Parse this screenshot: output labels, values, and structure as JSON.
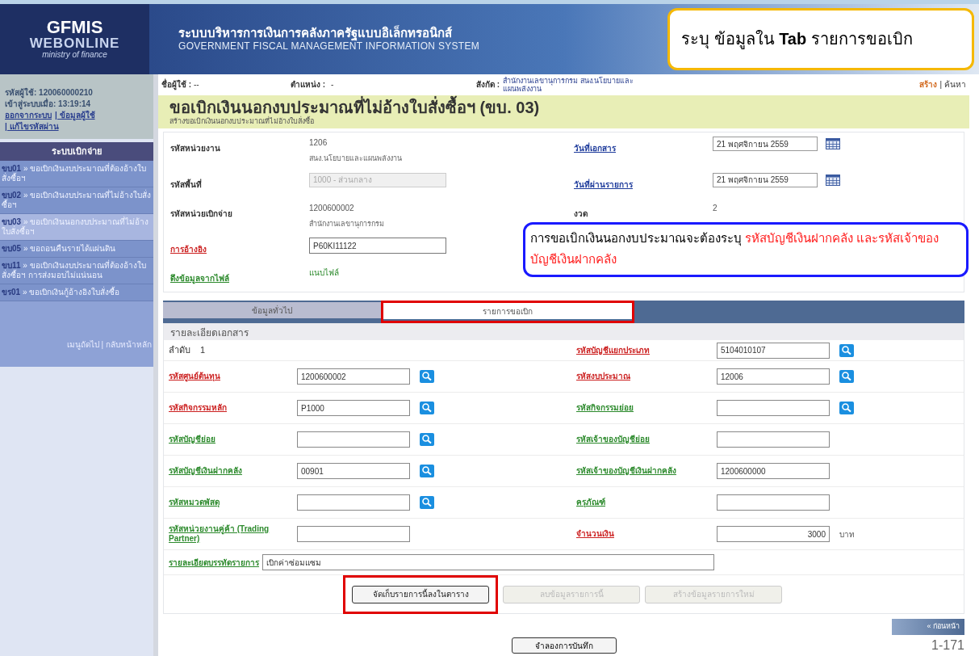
{
  "header": {
    "logo": [
      "GFMIS",
      "WEBONLINE",
      "ministry of finance"
    ],
    "title_th": "ระบบบริหารการเงินการคลังภาครัฐแบบอิเล็กทรอนิกส์",
    "title_en": "GOVERNMENT FISCAL MANAGEMENT INFORMATION SYSTEM"
  },
  "sidebar": {
    "user_id": "รหัสผู้ใช้: 120060000210",
    "login_time": "เข้าสู่ระบบเมื่อ: 13:19:14",
    "links": [
      "ออกจากระบบ",
      "| ข้อมูลผู้ใช้",
      "| แก้ไขรหัสผ่าน"
    ],
    "menu_title": "ระบบเบิกจ่าย",
    "menu_items": [
      {
        "code": "ขบ01",
        "label": "» ขอเบิกเงินงบประมาณที่ต้องอ้างใบสั่งซื้อฯ",
        "selected": false
      },
      {
        "code": "ขบ02",
        "label": "» ขอเบิกเงินงบประมาณที่ไม่อ้างใบสั่งซื้อฯ",
        "selected": false
      },
      {
        "code": "ขบ03",
        "label": "» ขอเบิกเงินนอกงบประมาณที่ไม่อ้างใบสั่งซื้อฯ",
        "selected": true
      },
      {
        "code": "ขบ05",
        "label": "» ขอถอนคืนรายได้แผ่นดิน",
        "selected": false
      },
      {
        "code": "ขบ11",
        "label": "» ขอเบิกเงินงบประมาณที่ต้องอ้างใบสั่งซื้อฯ การส่งมอบไม่แน่นอน",
        "selected": false
      },
      {
        "code": "ขร01",
        "label": "» ขอเบิกเงินกู้อ้างอิงใบสั่งซื้อ",
        "selected": false
      }
    ],
    "footer_links": [
      "เมนูถัดไป",
      "| กลับหน้าหลัก"
    ]
  },
  "topbar": {
    "user_label": "ชื่อผู้ใช้ :",
    "user_value": "--",
    "position_label": "ตำแหน่ง :",
    "position_value": "-",
    "org_label": "สังกัด :",
    "org_value": "สำนักงานเลขานุการกรม สนง.นโยบายและแผนพลังงาน",
    "actions": [
      {
        "label": "สร้าง",
        "selected": true
      },
      {
        "label": "| ค้นหา",
        "selected": false
      }
    ]
  },
  "page_title": "ขอเบิกเงินนอกงบประมาณที่ไม่อ้างใบสั่งซื้อฯ (ขบ. 03)",
  "page_subtitle": "สร้างขอเบิกเงินนอกงบประมาณที่ไม่อ้างใบสั่งซื้อ",
  "general_rows": [
    {
      "left": {
        "label": "รหัสหน่วยงาน",
        "link": false,
        "kind": "text",
        "value": "1206",
        "note": "สนง.นโยบายและแผนพลังงาน"
      },
      "right": {
        "label": "วันที่เอกสาร",
        "link": true,
        "required": false,
        "kind": "date",
        "value": "21 พฤศจิกายน 2559"
      }
    },
    {
      "left": {
        "label": "รหัสพื้นที่",
        "link": false,
        "kind": "select",
        "value": "1000 - ส่วนกลาง",
        "disabled": true
      },
      "right": {
        "label": "วันที่ผ่านรายการ",
        "link": true,
        "required": false,
        "kind": "date",
        "value": "21 พฤศจิกายน 2559"
      }
    },
    {
      "left": {
        "label": "รหัสหน่วยเบิกจ่าย",
        "link": false,
        "kind": "text",
        "value": "1200600002",
        "note": "สำนักงานเลขานุการกรม"
      },
      "right": {
        "label": "งวด",
        "link": false,
        "kind": "text",
        "value": "2"
      }
    },
    {
      "left": {
        "label": "การอ้างอิง",
        "link": true,
        "required": true,
        "kind": "input",
        "value": "P60KI11122"
      }
    },
    {
      "left": {
        "label": "ดึงข้อมูลจากไฟล์",
        "link": true,
        "required": false,
        "kind": "link",
        "value": "แนบไฟล์"
      }
    }
  ],
  "tabs": [
    {
      "label": "ข้อมูลทั่วไป",
      "selected": false,
      "highlighted": false
    },
    {
      "label": "รายการขอเบิก",
      "selected": true,
      "highlighted": true
    }
  ],
  "detail": {
    "title": "รายละเอียดเอกสาร",
    "rows": [
      {
        "left": {
          "kind": "seq",
          "label": "ลำดับ",
          "value": "1"
        },
        "right": {
          "kind": "input",
          "label": "รหัสบัญชีแยกประเภท",
          "required": true,
          "value": "5104010107",
          "lookup": true
        }
      },
      {
        "left": {
          "kind": "input",
          "label": "รหัสศูนย์ต้นทุน",
          "required": true,
          "value": "1200600002",
          "lookup": true
        },
        "right": {
          "kind": "input",
          "label": "รหัสงบประมาณ",
          "required": true,
          "value": "12006",
          "lookup": true
        }
      },
      {
        "left": {
          "kind": "input",
          "label": "รหัสกิจกรรมหลัก",
          "required": true,
          "value": "P1000",
          "lookup": true
        },
        "right": {
          "kind": "input",
          "label": "รหัสกิจกรรมย่อย",
          "required": false,
          "lookup": true
        }
      },
      {
        "left": {
          "kind": "input",
          "label": "รหัสบัญชีย่อย",
          "required": false,
          "lookup": true
        },
        "right": {
          "kind": "input",
          "label": "รหัสเจ้าของบัญชีย่อย",
          "required": false,
          "lookup": false
        }
      },
      {
        "left": {
          "kind": "input",
          "label": "รหัสบัญชีเงินฝากคลัง",
          "required": false,
          "value": "00901",
          "lookup": true
        },
        "right": {
          "kind": "input",
          "label": "รหัสเจ้าของบัญชีเงินฝากคลัง",
          "required": false,
          "value": "1200600000",
          "lookup": false
        }
      },
      {
        "left": {
          "kind": "input",
          "label": "รหัสหมวดพัสดุ",
          "required": false,
          "lookup": true
        },
        "right": {
          "kind": "input",
          "label": "ครุภัณฑ์",
          "required": false,
          "lookup": false
        }
      },
      {
        "left": {
          "kind": "input",
          "label": "รหัสหน่วยงานคู่ค้า (Trading Partner)",
          "required": false,
          "lookup": false
        },
        "right": {
          "kind": "amount",
          "label": "จำนวนเงิน",
          "required": true,
          "value": "3000",
          "unit": "บาท",
          "lookup": false
        }
      }
    ],
    "line_label": "รายละเอียดบรรทัดรายการ",
    "line_required": false,
    "line_value": "เบิกค่าซ่อมแซม"
  },
  "buttons": [
    {
      "label": "จัดเก็บรายการนี้ลงในตาราง",
      "disabled": false,
      "highlighted": true
    },
    {
      "label": "ลบข้อมูลรายการนี้",
      "disabled": true,
      "highlighted": false
    },
    {
      "label": "สร้างข้อมูลรายการใหม่",
      "disabled": true,
      "highlighted": false
    }
  ],
  "previous": "« ก่อนหน้า",
  "simulate": "จำลองการบันทึก",
  "page_number": "1-171",
  "callouts": {
    "tab_hint": "ระบุ ข้อมูลใน **Tab** รายการขอเบิก",
    "note_text": "การขอเบิกเงินนอกงบประมาณจะต้องระบุ",
    "note_emphasis": "รหัสบัญชีเงินฝากคลัง และรหัสเจ้าของบัญชีเงินฝากคลัง"
  }
}
